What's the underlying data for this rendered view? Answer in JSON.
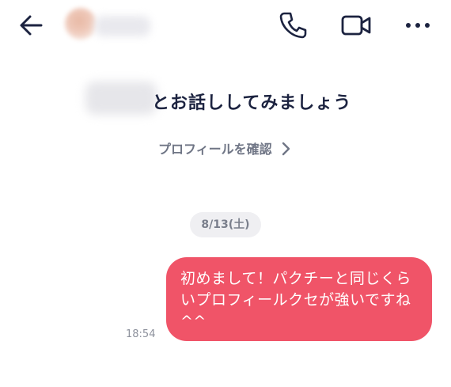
{
  "header": {
    "back_icon": "arrow-left-icon",
    "call_icon": "phone-icon",
    "video_icon": "video-camera-icon",
    "more_icon": "more-dots-icon"
  },
  "intro": {
    "title": "とお話ししてみましょう",
    "profile_link": "プロフィールを確認"
  },
  "chat": {
    "date": "8/13(土)",
    "messages": [
      {
        "text": "初めまして！パクチーと同じくらいプロフィールクセが強いですね^^",
        "time": "18:54",
        "sender": "self"
      }
    ]
  },
  "colors": {
    "accent": "#f05468",
    "text": "#1c2340",
    "muted": "#6f7585"
  }
}
